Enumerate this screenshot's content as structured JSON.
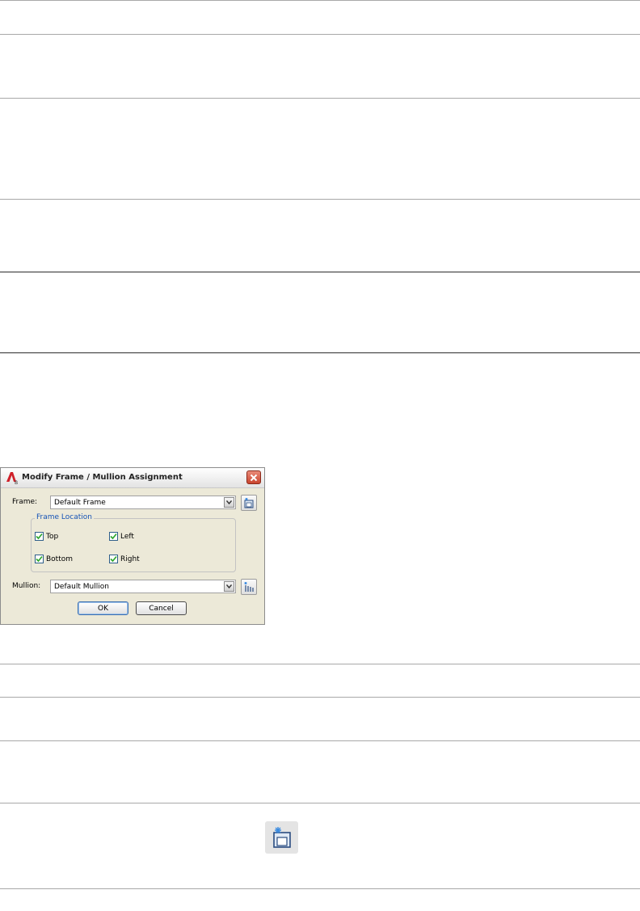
{
  "dialog": {
    "title": "Modify Frame / Mullion Assignment",
    "frame_label": "Frame:",
    "frame_value": "Default Frame",
    "frame_location_label": "Frame Location",
    "checkboxes": [
      {
        "label": "Top",
        "checked": true
      },
      {
        "label": "Left",
        "checked": true
      },
      {
        "label": "Bottom",
        "checked": true
      },
      {
        "label": "Right",
        "checked": true
      }
    ],
    "mullion_label": "Mullion:",
    "mullion_value": "Default Mullion",
    "ok_label": "OK",
    "cancel_label": "Cancel"
  },
  "icons": {
    "app": "autocad-architecture-icon",
    "close": "close-icon",
    "frame_tool": "new-frame-icon",
    "mullion_tool": "new-mullion-icon",
    "standalone": "new-frame-icon"
  },
  "colors": {
    "dialog_bg": "#ece9d8",
    "legend_text": "#1553b6",
    "close_red": "#c9452e",
    "check_green": "#2aa52a"
  }
}
